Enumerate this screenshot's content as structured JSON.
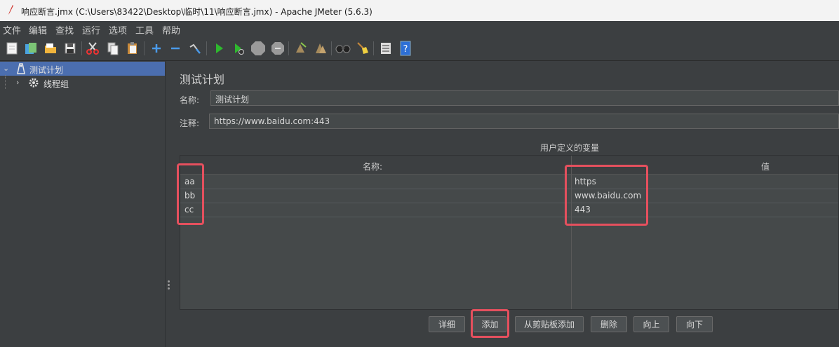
{
  "window": {
    "title": "响应断言.jmx (C:\\Users\\83422\\Desktop\\临时\\11\\响应断言.jmx) - Apache JMeter (5.6.3)"
  },
  "menu": [
    "文件",
    "编辑",
    "查找",
    "运行",
    "选项",
    "工具",
    "帮助"
  ],
  "toolbar": {
    "icons": [
      "new-icon",
      "templates-icon",
      "open-icon",
      "save-icon",
      "cut-icon",
      "copy-icon",
      "paste-icon",
      "expand-icon",
      "collapse-icon",
      "toggle-icon",
      "start-icon",
      "start-no-pause-icon",
      "stop-icon",
      "shutdown-icon",
      "clear-icon",
      "clear-all-icon",
      "search-icon",
      "reset-search-icon",
      "function-helper-icon",
      "help-icon"
    ]
  },
  "tree": {
    "items": [
      {
        "label": "测试计划",
        "icon": "test-plan-icon",
        "selected": true,
        "expanded": true
      },
      {
        "label": "线程组",
        "icon": "gear-icon",
        "selected": false,
        "expanded": false
      }
    ]
  },
  "panel": {
    "title": "测试计划",
    "name_label": "名称:",
    "name_value": "测试计划",
    "comment_label": "注释:",
    "comment_value": "https://www.baidu.com:443",
    "group_title": "用户定义的变量"
  },
  "table": {
    "headers": [
      "名称:",
      "值"
    ],
    "rows": [
      {
        "name": "aa",
        "value": "https"
      },
      {
        "name": "bb",
        "value": "www.baidu.com"
      },
      {
        "name": "cc",
        "value": "443"
      }
    ]
  },
  "buttons": {
    "detail": "详细",
    "add": "添加",
    "add_clipboard": "从剪贴板添加",
    "delete": "删除",
    "up": "向上",
    "down": "向下"
  },
  "colors": {
    "selection": "#4b6eaf",
    "highlight": "#e5505e",
    "start": "#2eb82e"
  }
}
